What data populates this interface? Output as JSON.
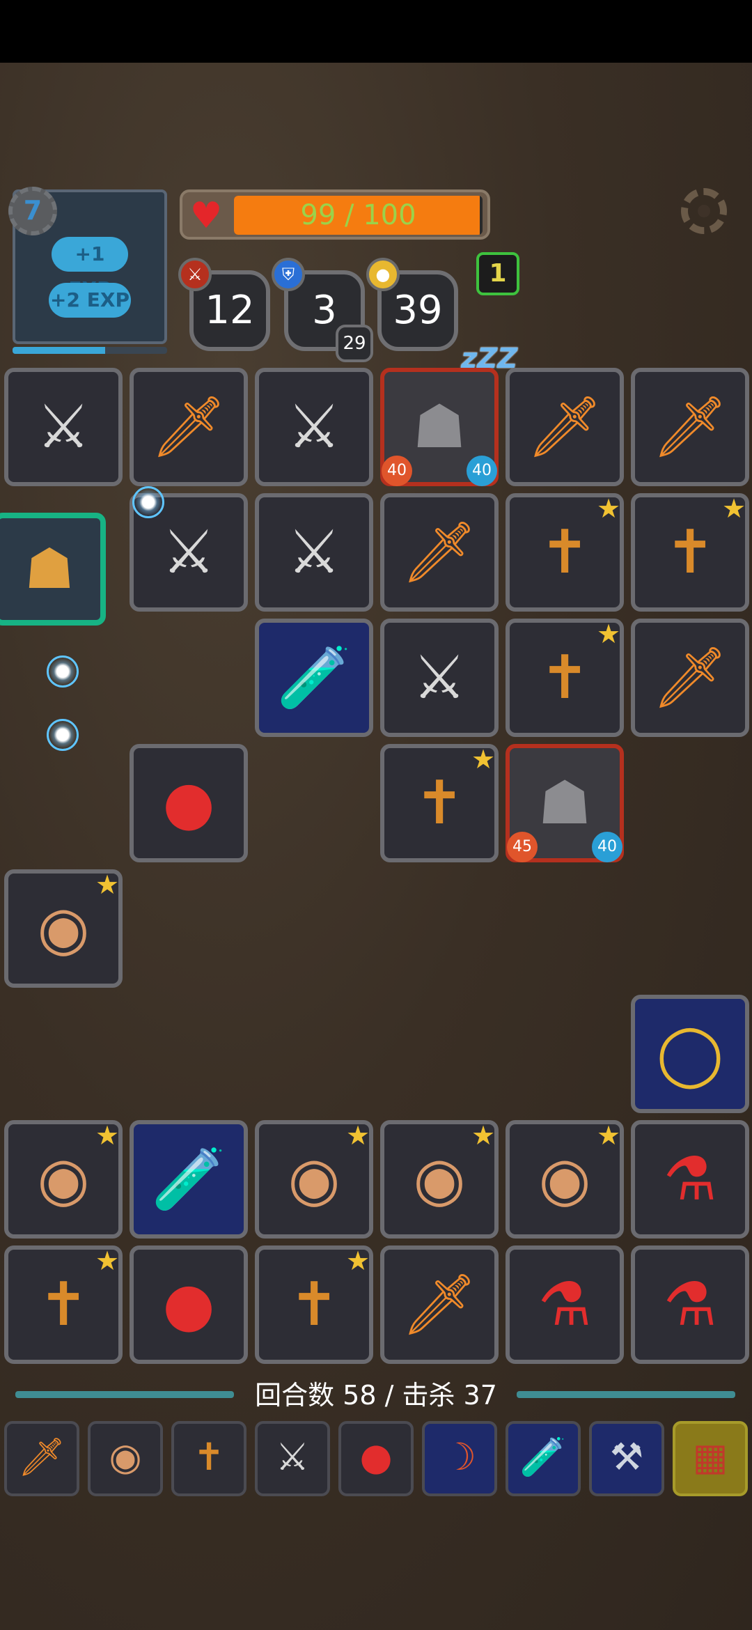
{
  "player": {
    "level": "7",
    "exp_popups": [
      "+1 EXP",
      "+2 EXP"
    ],
    "xp_fill": 0.6
  },
  "health": {
    "current": 99,
    "max": 100,
    "text": "99 / 100"
  },
  "stats": {
    "attack": "12",
    "defense": "3",
    "defense_sub": "29",
    "gold": "39"
  },
  "badge": "1",
  "colors": {
    "hp": "#f57c10",
    "hp_text": "#9bd24a",
    "accent_green": "#17b384",
    "enemy_border": "#b5301e"
  },
  "grid": [
    {
      "icon": "crossed-swords-icon",
      "glyph": "⚔",
      "color": "#d9d9d9"
    },
    {
      "icon": "flaming-sword-icon",
      "glyph": "🗡",
      "color": "#f08a2a"
    },
    {
      "icon": "crossed-swords-icon",
      "glyph": "⚔",
      "color": "#d9d9d9"
    },
    {
      "icon": "stone-golem-icon",
      "glyph": "☗",
      "color": "#8c8c90",
      "enemy": true,
      "atk": "40",
      "def": "40"
    },
    {
      "icon": "flaming-sword-icon",
      "glyph": "🗡",
      "color": "#f08a2a"
    },
    {
      "icon": "flaming-sword-icon",
      "glyph": "🗡",
      "color": "#f08a2a"
    },
    {
      "icon": "crossed-swords-icon",
      "glyph": "⚔",
      "color": "#d9d9d9"
    },
    {
      "icon": "crossed-swords-icon",
      "glyph": "⚔",
      "color": "#d9d9d9"
    },
    {
      "icon": "flaming-sword-icon",
      "glyph": "🗡",
      "color": "#f08a2a"
    },
    {
      "icon": "scarecrow-armor-icon",
      "glyph": "✝",
      "color": "#d98a2a",
      "star": true
    },
    {
      "icon": "scarecrow-armor-icon",
      "glyph": "✝",
      "color": "#d98a2a",
      "star": true
    },
    {
      "icon": "green-potion-icon",
      "glyph": "🧪",
      "color": "#35c07a",
      "blue": true
    },
    {
      "icon": "crossed-swords-icon",
      "glyph": "⚔",
      "color": "#d9d9d9"
    },
    {
      "icon": "scarecrow-armor-icon",
      "glyph": "✝",
      "color": "#d98a2a",
      "star": true
    },
    {
      "icon": "flaming-sword-icon",
      "glyph": "🗡",
      "color": "#f08a2a"
    },
    {
      "icon": "red-bomb-potion-icon",
      "glyph": "●",
      "color": "#e22d2d"
    },
    {
      "icon": "scarecrow-armor-icon",
      "glyph": "✝",
      "color": "#d98a2a",
      "star": true
    },
    {
      "icon": "stone-golem-icon",
      "glyph": "☗",
      "color": "#8c8c90",
      "enemy": true,
      "atk": "45",
      "def": "40"
    },
    {
      "icon": "round-shield-icon",
      "glyph": "◉",
      "color": "#d99a6a",
      "star": true
    },
    {
      "icon": "gold-ring-icon",
      "glyph": "◯",
      "color": "#e8b830",
      "blue": true
    },
    {
      "icon": "round-shield-icon",
      "glyph": "◉",
      "color": "#d99a6a",
      "star": true
    },
    {
      "icon": "green-potion-icon",
      "glyph": "🧪",
      "color": "#35c07a",
      "blue": true
    },
    {
      "icon": "round-shield-icon",
      "glyph": "◉",
      "color": "#d99a6a",
      "star": true
    },
    {
      "icon": "round-shield-icon",
      "glyph": "◉",
      "color": "#d99a6a",
      "star": true
    },
    {
      "icon": "round-shield-icon",
      "glyph": "◉",
      "color": "#d99a6a",
      "star": true
    },
    {
      "icon": "red-potion-flask-icon",
      "glyph": "⚗",
      "color": "#e22d2d"
    },
    {
      "icon": "scarecrow-armor-icon",
      "glyph": "✝",
      "color": "#d98a2a",
      "star": true
    },
    {
      "icon": "red-bomb-potion-icon",
      "glyph": "●",
      "color": "#e22d2d"
    },
    {
      "icon": "scarecrow-armor-icon",
      "glyph": "✝",
      "color": "#d98a2a",
      "star": true
    },
    {
      "icon": "flaming-sword-icon",
      "glyph": "🗡",
      "color": "#f08a2a"
    },
    {
      "icon": "red-potion-flask-icon",
      "glyph": "⚗",
      "color": "#e22d2d"
    },
    {
      "icon": "red-potion-flask-icon",
      "glyph": "⚗",
      "color": "#e22d2d"
    }
  ],
  "turn_info": "回合数 58 / 击杀 37",
  "toolbar": [
    {
      "icon": "flaming-sword-icon",
      "glyph": "🗡",
      "color": "#f08a2a"
    },
    {
      "icon": "round-shield-icon",
      "glyph": "◉",
      "color": "#d99a6a"
    },
    {
      "icon": "scarecrow-armor-icon",
      "glyph": "✝",
      "color": "#d98a2a"
    },
    {
      "icon": "crossed-swords-icon",
      "glyph": "⚔",
      "color": "#d9d9d9"
    },
    {
      "icon": "red-bomb-potion-icon",
      "glyph": "●",
      "color": "#e22d2d"
    },
    {
      "icon": "scythe-icon",
      "glyph": "☽",
      "color": "#e0552b",
      "blue": true
    },
    {
      "icon": "green-potion-icon",
      "glyph": "🧪",
      "color": "#35c07a",
      "blue": true
    },
    {
      "icon": "battle-axe-icon",
      "glyph": "⚒",
      "color": "#cfd6e0",
      "blue": true
    },
    {
      "icon": "scroll-card-icon",
      "glyph": "▦",
      "color": "#c0392b",
      "gold": true
    }
  ]
}
